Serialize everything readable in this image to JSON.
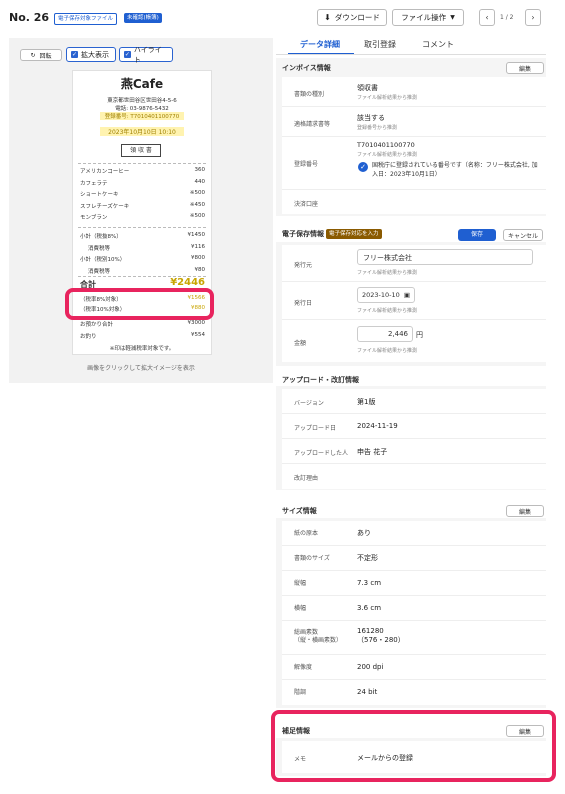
{
  "header": {
    "doc_no": "No. 26",
    "badge1": "電子保存対象ファイル",
    "badge2": "未確認(帳簿)",
    "download": "ダウンロード",
    "file_ops": "ファイル操作",
    "page": "1 / 2"
  },
  "preview": {
    "rotate": "回転",
    "zoom": "拡大表示",
    "highlight": "ハイライト",
    "caption": "画像をクリックして拡大イメージを表示"
  },
  "receipt": {
    "store": "燕Cafe",
    "address": "東京都世田谷区世田谷4-5-6",
    "phone": "電話: 03-9876-5432",
    "reg": "登録番号: T7010401100770",
    "date": "2023年10月10日  10:10",
    "title": "領 収 書",
    "items": [
      [
        "アメリカンコーヒー",
        "360"
      ],
      [
        "カフェラテ",
        "440"
      ],
      [
        "ショートケーキ",
        "※500"
      ],
      [
        "スフレチーズケーキ",
        "※450"
      ],
      [
        "モンブラン",
        "※500"
      ]
    ],
    "subtotals": [
      [
        "小計（税抜8%）",
        "¥1450"
      ],
      [
        "消費税等",
        "¥116"
      ],
      [
        "小計（税別10%）",
        "¥800"
      ],
      [
        "消費税等",
        "¥80"
      ]
    ],
    "total_label": "合計",
    "total": "¥2446",
    "tax_rows": [
      [
        "（税率8%対象）",
        "¥1566"
      ],
      [
        "（税率10%対象）",
        "¥880"
      ]
    ],
    "deposit": [
      "お預かり合計",
      "¥3000"
    ],
    "change": [
      "お釣り",
      "¥554"
    ],
    "note": "※印は軽減税率対象です。"
  },
  "tabs": [
    "データ詳細",
    "取引登録",
    "コメント"
  ],
  "invoice": {
    "title": "インボイス情報",
    "edit": "編集",
    "rows": [
      {
        "label": "書類の種別",
        "value": "領収書",
        "sub": "ファイル解析結果から推測"
      },
      {
        "label": "適格請求書等",
        "value": "該当する",
        "sub": "登録番号から推測"
      },
      {
        "label": "登録番号",
        "value": "T7010401100770",
        "sub": "ファイル解析結果から推測",
        "check": "国税庁に登録されている番号です（名称：フリー株式会社, 加入日：2023年10月1日）"
      },
      {
        "label": "決済口座",
        "value": "",
        "sub": ""
      }
    ]
  },
  "epreserve": {
    "title": "電子保存情報",
    "badge": "電子保存対応を入力",
    "save": "保存",
    "cancel": "キャンセル",
    "issuer_label": "発行元",
    "issuer": "フリー株式会社",
    "issuer_sub": "ファイル解析結果から推測",
    "date_label": "発行日",
    "date": "2023-10-10",
    "date_sub": "ファイル解析結果から推測",
    "amount_label": "金額",
    "amount": "2,446",
    "yen": "円",
    "amount_sub": "ファイル解析結果から推測"
  },
  "upload": {
    "title": "アップロード・改訂情報",
    "rows": [
      [
        "バージョン",
        "第1版"
      ],
      [
        "アップロード日",
        "2024-11-19"
      ],
      [
        "アップロードした人",
        "申告 花子"
      ],
      [
        "改訂理由",
        ""
      ]
    ]
  },
  "size": {
    "title": "サイズ情報",
    "edit": "編集",
    "rows": [
      [
        "紙の原本",
        "あり"
      ],
      [
        "書類のサイズ",
        "不定形"
      ],
      [
        "縦幅",
        "7.3 cm"
      ],
      [
        "横幅",
        "3.6 cm"
      ],
      [
        "総画素数\n（縦・横画素数）",
        "161280\n（576・280）"
      ],
      [
        "解像度",
        "200 dpi"
      ],
      [
        "階調",
        "24 bit"
      ]
    ]
  },
  "extra": {
    "title": "補足情報",
    "edit": "編集",
    "memo_label": "メモ",
    "memo": "メールからの登録"
  },
  "colors": {
    "accent": "#1f5fd1",
    "highlight": "#e8245e",
    "gold": "#c8a400"
  }
}
